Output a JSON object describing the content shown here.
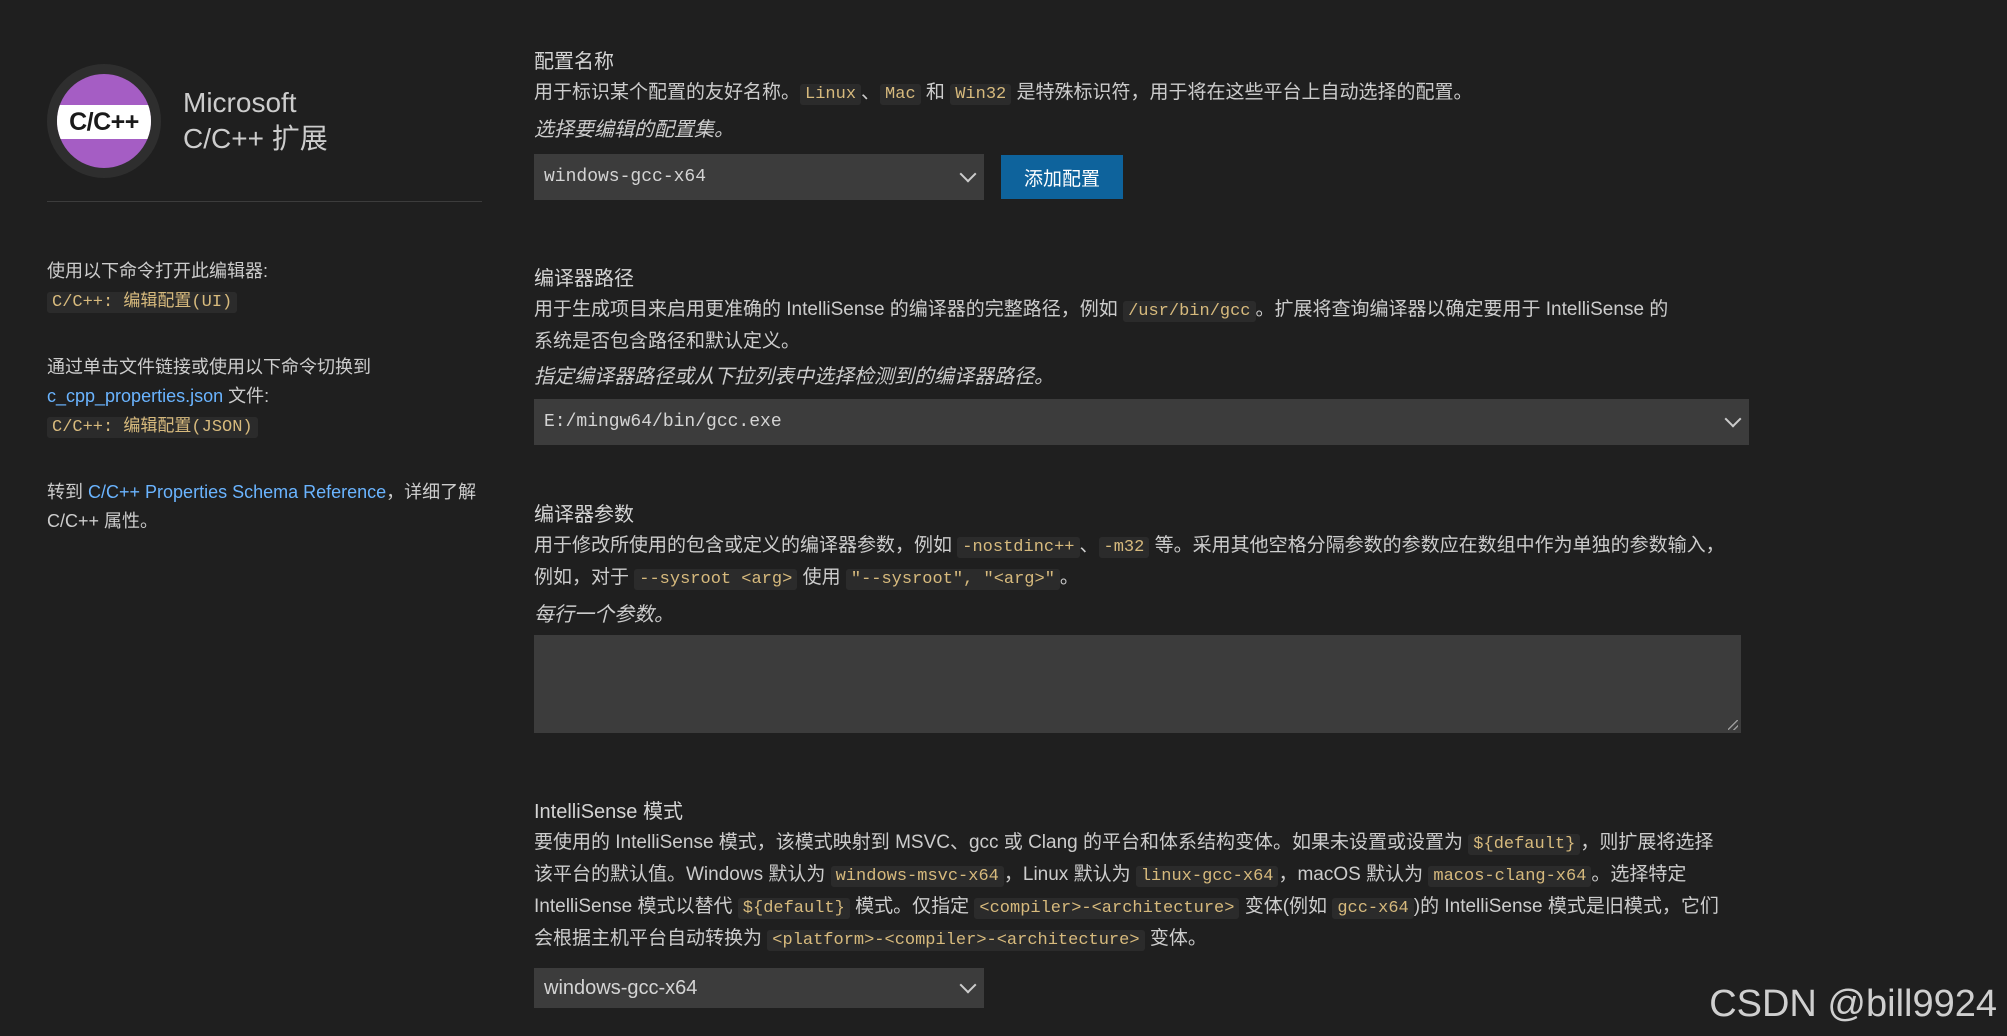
{
  "extension": {
    "logo_text": "C/C++",
    "name_line1": "Microsoft",
    "name_line2": "C/C++ 扩展"
  },
  "sidebar": {
    "open_ui_label": "使用以下命令打开此编辑器:",
    "open_ui_command": "C/C++: 编辑配置(UI)",
    "switch_json_label_1": "通过单击文件链接或使用以下命令切换到",
    "switch_json_file_link": "c_cpp_properties.json",
    "switch_json_label_2": " 文件:",
    "switch_json_command": "C/C++: 编辑配置(JSON)",
    "schema_prefix": "转到 ",
    "schema_link": "C/C++ Properties Schema Reference",
    "schema_suffix": "，详细了解 C/C++ 属性。"
  },
  "config_name": {
    "title": "配置名称",
    "desc_1": "用于标识某个配置的友好名称。",
    "code_linux": "Linux",
    "sep_1": "、",
    "code_mac": "Mac",
    "and": " 和 ",
    "code_win32": "Win32",
    "desc_2": " 是特殊标识符，用于将在这些平台上自动选择的配置。",
    "hint": "选择要编辑的配置集。",
    "selected": "windows-gcc-x64",
    "add_button": "添加配置"
  },
  "compiler_path": {
    "title": "编译器路径",
    "desc_1": "用于生成项目来启用更准确的 IntelliSense 的编译器的完整路径，例如 ",
    "code_example": "/usr/bin/gcc",
    "desc_2": "。扩展将查询编译器以确定要用于 IntelliSense 的系统是否包含路径和默认定义。",
    "hint": "指定编译器路径或从下拉列表中选择检测到的编译器路径。",
    "value": "E:/mingw64/bin/gcc.exe"
  },
  "compiler_args": {
    "title": "编译器参数",
    "desc_1": "用于修改所使用的包含或定义的编译器参数，例如 ",
    "code_1": "-nostdinc++",
    "sep_1": "、",
    "code_2": "-m32",
    "desc_2": " 等。采用其他空格分隔参数的参数应在数组中作为单独的参数输入，例如，对于 ",
    "code_3": "--sysroot <arg>",
    "desc_3": " 使用 ",
    "code_4": "\"--sysroot\", \"<arg>\"",
    "desc_4": "。",
    "hint": "每行一个参数。",
    "value": ""
  },
  "intellisense_mode": {
    "title": "IntelliSense 模式",
    "desc_1": "要使用的 IntelliSense 模式，该模式映射到 MSVC、gcc 或 Clang 的平台和体系结构变体。如果未设置或设置为 ",
    "code_default": "${default}",
    "desc_2": "，则扩展将选择该平台的默认值。Windows 默认为 ",
    "code_win": "windows-msvc-x64",
    "desc_3": "，Linux 默认为 ",
    "code_linux": "linux-gcc-x64",
    "desc_4": "，macOS 默认为 ",
    "code_mac": "macos-clang-x64",
    "desc_5": "。选择特定 IntelliSense 模式以替代 ",
    "code_default_2": "${default}",
    "desc_6": " 模式。仅指定 ",
    "code_ca": "<compiler>-<architecture>",
    "desc_7": " 变体(例如 ",
    "code_gcc": "gcc-x64",
    "desc_8": ")的 IntelliSense 模式是旧模式，它们会根据主机平台自动转换为 ",
    "code_pca": "<platform>-<compiler>-<architecture>",
    "desc_9": " 变体。",
    "selected": "windows-gcc-x64"
  },
  "watermark": "CSDN @bill9924"
}
